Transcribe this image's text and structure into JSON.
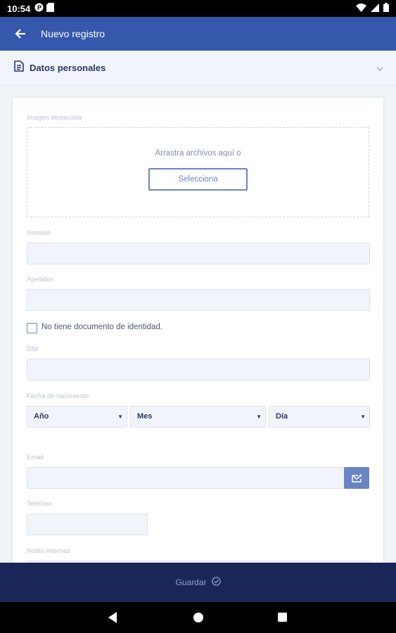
{
  "status_bar": {
    "time": "10:54",
    "icons": [
      "app-notification-icon",
      "sd-card-icon",
      "wifi-icon",
      "signal-icon",
      "battery-icon"
    ]
  },
  "app_bar": {
    "title": "Nuevo registro",
    "back_icon": "arrow-back-icon"
  },
  "section": {
    "title": "Datos personales",
    "icon": "document-icon",
    "expand_icon": "chevron-down-icon"
  },
  "form": {
    "featured_image": {
      "label": "Imagen destacada",
      "drop_text": "Arrastra archivos aquí o",
      "select_button": "Selecciona"
    },
    "nombre_label": "Nombre",
    "apellidos_label": "Apellidos",
    "no_id_checkbox": "No tiene documento de identidad.",
    "dni_label": "DNI",
    "birthdate": {
      "label": "Fecha de nacimiento",
      "year": "Año",
      "month": "Mes",
      "day": "Día"
    },
    "email_label": "Email",
    "email_icon": "mail-send-icon",
    "telefono_label": "Teléfono",
    "notas_label": "Notas internas"
  },
  "footer": {
    "save_label": "Guardar",
    "save_icon": "check-circle-icon"
  },
  "nav_bar": {
    "icons": [
      "back-triangle-icon",
      "home-circle-icon",
      "recents-square-icon"
    ]
  },
  "colors": {
    "app_bar": "#3557ac",
    "accent": "#6b85c4",
    "footer": "#1a2558",
    "section_title": "#2b3a67"
  }
}
